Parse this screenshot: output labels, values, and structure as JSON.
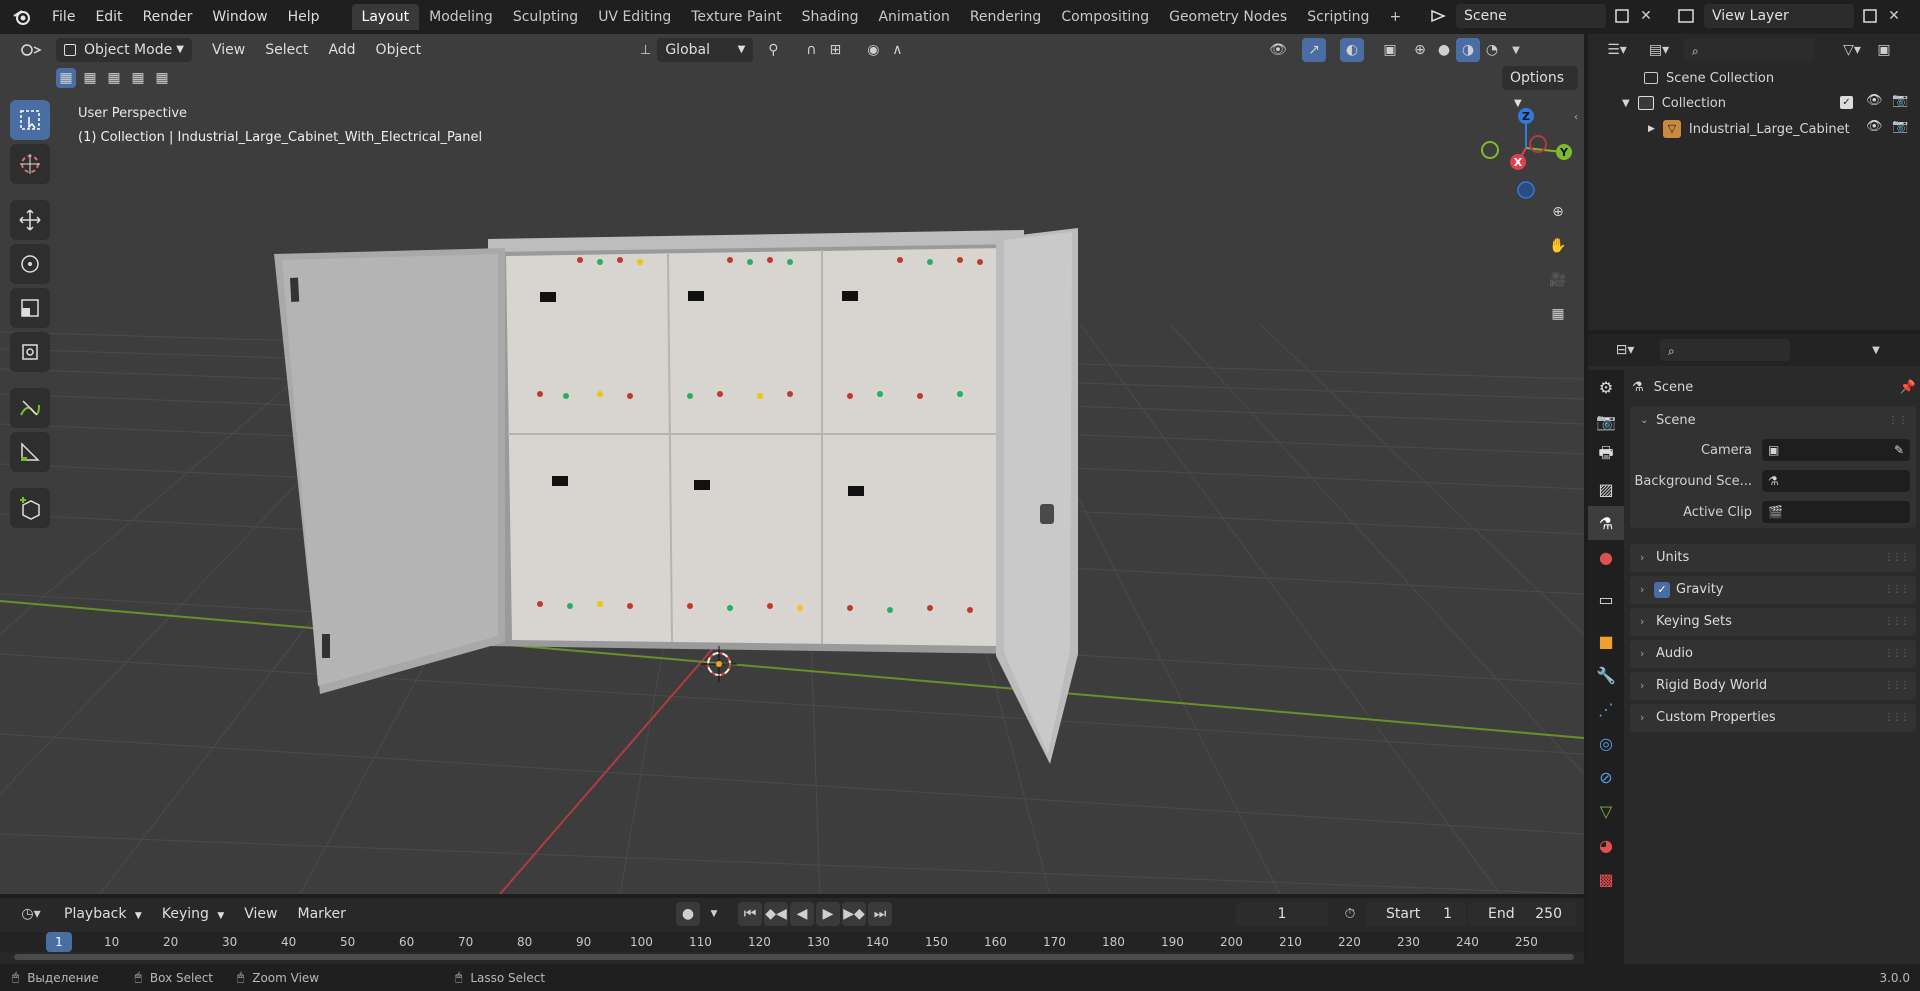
{
  "topbar": {
    "menus": [
      "File",
      "Edit",
      "Render",
      "Window",
      "Help"
    ],
    "workspaces": [
      "Layout",
      "Modeling",
      "Sculpting",
      "UV Editing",
      "Texture Paint",
      "Shading",
      "Animation",
      "Rendering",
      "Compositing",
      "Geometry Nodes",
      "Scripting"
    ],
    "add_tab": "+",
    "scene_name": "Scene",
    "view_layer": "View Layer"
  },
  "viewport": {
    "mode": "Object Mode",
    "menus": [
      "View",
      "Select",
      "Add",
      "Object"
    ],
    "transform_orientation": "Global",
    "options_label": "Options",
    "overlay_title": "User Perspective",
    "overlay_subtitle": "(1) Collection | Industrial_Large_Cabinet_With_Electrical_Panel",
    "gizmo": {
      "x": "X",
      "y": "Y",
      "z": "Z"
    }
  },
  "outliner": {
    "root": "Scene Collection",
    "collection": "Collection",
    "object": "Industrial_Large_Cabinet"
  },
  "properties": {
    "header": "Scene",
    "section": "Scene",
    "fields": [
      {
        "label": "Camera"
      },
      {
        "label": "Background Sce..."
      },
      {
        "label": "Active Clip"
      }
    ],
    "panels": [
      "Units",
      "Gravity",
      "Keying Sets",
      "Audio",
      "Rigid Body World",
      "Custom Properties"
    ]
  },
  "timeline": {
    "menus": [
      "Playback",
      "Keying",
      "View",
      "Marker"
    ],
    "current_frame": "1",
    "start_label": "Start",
    "start_value": "1",
    "end_label": "End",
    "end_value": "250",
    "ruler": [
      "1",
      "10",
      "20",
      "30",
      "40",
      "50",
      "60",
      "70",
      "80",
      "90",
      "100",
      "110",
      "120",
      "130",
      "140",
      "150",
      "160",
      "170",
      "180",
      "190",
      "200",
      "210",
      "220",
      "230",
      "240",
      "250"
    ]
  },
  "statusbar": {
    "items": [
      "Выделение",
      "Box Select",
      "Zoom View",
      "Lasso Select"
    ],
    "version": "3.0.0"
  },
  "colors": {
    "accent": "#4a6ea3",
    "x_axis": "#e0404e",
    "y_axis": "#7dbb2d",
    "z_axis": "#2f7be0"
  }
}
